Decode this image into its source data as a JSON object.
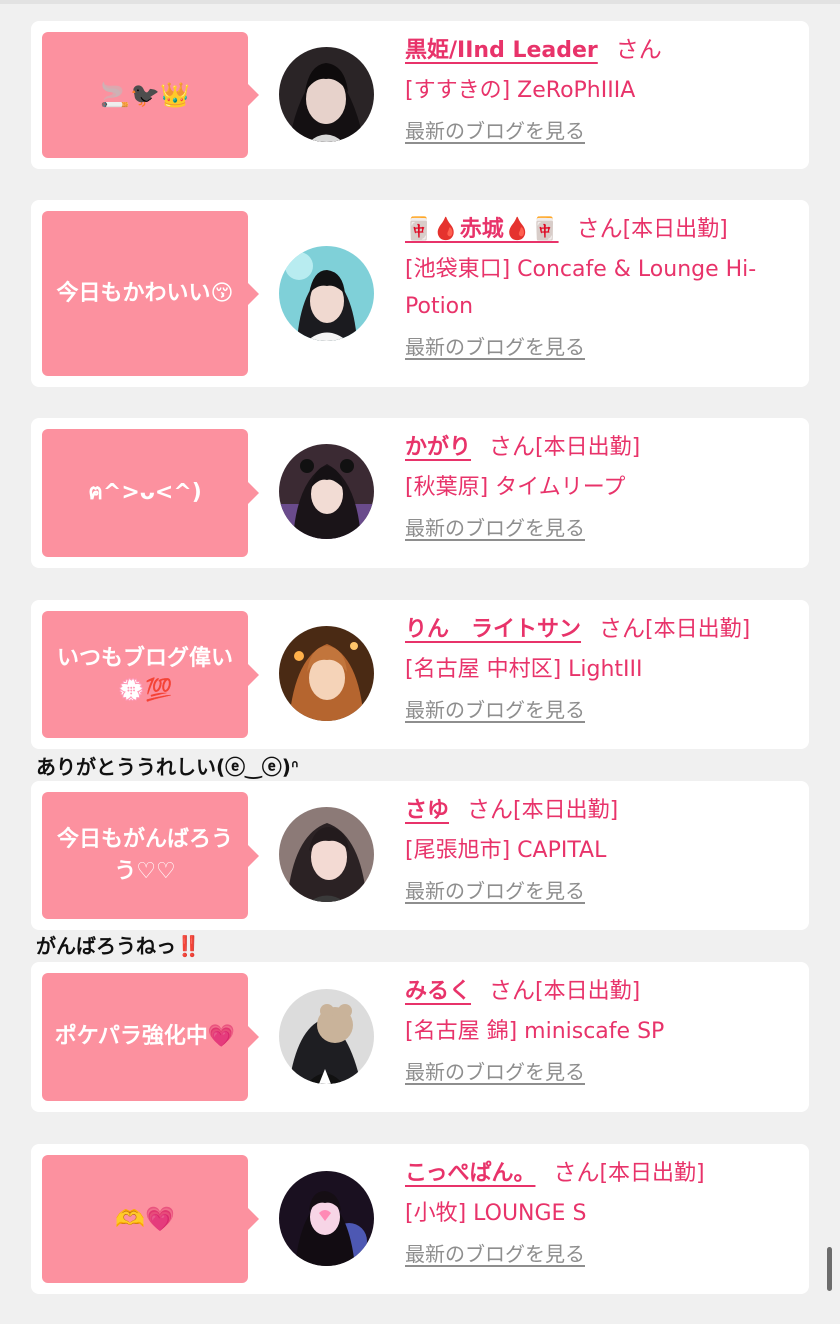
{
  "entries": [
    {
      "bubble": "🚬🐦‍⬛👑",
      "name": "黒姫/IInd Leader",
      "san": "さん",
      "status": "",
      "shop": "[すすきの] ZeRoPhIIIA",
      "blog": "最新のブログを見る",
      "comment": ""
    },
    {
      "bubble": "今日もかわいい😚",
      "name": "🀄🩸赤城🩸🀄",
      "san": "さん",
      "status": "[本日出勤]",
      "shop": "[池袋東口] Concafe & Lounge Hi-Potion",
      "blog": "最新のブログを見る",
      "comment": ""
    },
    {
      "bubble": "ฅ^>ᴗ<^)",
      "name": "かがり",
      "san": "さん",
      "status": "[本日出勤]",
      "shop": "[秋葉原] タイムリープ",
      "blog": "最新のブログを見る",
      "comment": ""
    },
    {
      "bubble": "いつもブログ偉い💮💯",
      "name": "りん　ライトサン",
      "san": "さん",
      "status": "[本日出勤]",
      "shop": "[名古屋 中村区] LightIII",
      "blog": "最新のブログを見る",
      "comment": "ありがとううれしい(ⓔ‿ⓔ)ᐢ"
    },
    {
      "bubble": "今日もがんばろうう♡♡",
      "name": "さゆ",
      "san": "さん",
      "status": "[本日出勤]",
      "shop": "[尾張旭市] CAPITAL",
      "blog": "最新のブログを見る",
      "comment": "がんばろうねっ‼️"
    },
    {
      "bubble": "ポケパラ強化中💗",
      "name": "みるく",
      "san": "さん",
      "status": "[本日出勤]",
      "shop": "[名古屋 錦] miniscafe SP",
      "blog": "最新のブログを見る",
      "comment": ""
    },
    {
      "bubble": "🫶💗",
      "name": "こっぺぱん。",
      "san": "さん",
      "status": "[本日出勤]",
      "shop": "[小牧] LOUNGE S",
      "blog": "最新のブログを見る",
      "comment": ""
    }
  ],
  "colors": {
    "accent": "#e8336a",
    "bubble": "#fc919f",
    "link_gray": "#8e8e8e",
    "background": "#f0f0f0"
  }
}
